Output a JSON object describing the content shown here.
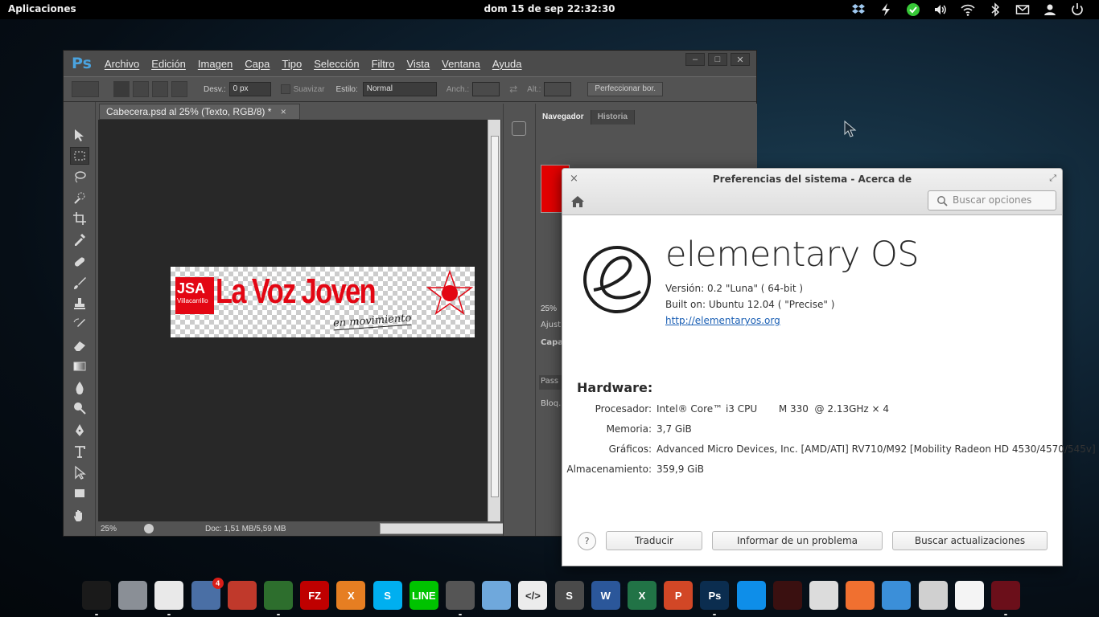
{
  "top_panel": {
    "apps_label": "Aplicaciones",
    "clock": "dom 15 de sep 22:32:30",
    "indicators": [
      "dropbox-icon",
      "power-icon",
      "update-check-icon",
      "volume-icon",
      "wifi-icon",
      "bluetooth-icon",
      "mail-icon",
      "user-icon",
      "shutdown-icon"
    ]
  },
  "photoshop": {
    "logo": "Ps",
    "menu": [
      "Archivo",
      "Edición",
      "Imagen",
      "Capa",
      "Tipo",
      "Selección",
      "Filtro",
      "Vista",
      "Ventana",
      "Ayuda"
    ],
    "window_controls": [
      "–",
      "□",
      "✕"
    ],
    "options": {
      "feather_label": "Desv.:",
      "feather_value": "0 px",
      "antialias_label": "Suavizar",
      "style_label": "Estilo:",
      "style_value": "Normal",
      "width_label": "Anch.:",
      "height_label": "Alt.:",
      "refine_button": "Perfeccionar bor."
    },
    "document_tab": "Cabecera.psd al 25% (Texto, RGB/8) *",
    "document_tab_close": "×",
    "status": {
      "zoom": "25%",
      "doc_size": "Doc: 1,51 MB/5,59 MB"
    },
    "panel_tabs": [
      "Navegador",
      "Historia"
    ],
    "nav_zoom": "25%",
    "panel_labels": [
      "Ajust",
      "Capa",
      "Pass",
      "Bloq.:"
    ],
    "artwork": {
      "badge": "JSA",
      "badge_sub": "Villacarrillo",
      "headline": "La Voz Joven",
      "tagline": "en movimiento"
    }
  },
  "prefs": {
    "title": "Preferencias del sistema - Acerca de",
    "close_icon": "×",
    "search_placeholder": "Buscar opciones",
    "os_name": "elementary OS",
    "version": "Versión: 0.2 \"Luna\" ( 64-bit )",
    "built_on": "Built on: Ubuntu 12.04 ( \"Precise\" )",
    "link": "http://elementaryos.org",
    "hardware_title": "Hardware:",
    "hardware": [
      {
        "label": "Procesador:",
        "value": "Intel® Core™ i3 CPU       M 330  @ 2.13GHz × 4"
      },
      {
        "label": "Memoria:",
        "value": "3,7 GiB"
      },
      {
        "label": "Gráficos:",
        "value": "Advanced Micro Devices, Inc. [AMD/ATI] RV710/M92 [Mobility Radeon HD 4530/4570/545v]"
      },
      {
        "label": "Almacenamiento:",
        "value": "359,9 GiB"
      }
    ],
    "help_label": "?",
    "buttons": {
      "translate": "Traducir",
      "report": "Informar de un problema",
      "updates": "Buscar actualizaciones"
    }
  },
  "dock": {
    "items": [
      {
        "name": "terminal-icon",
        "label": "",
        "color": "#1a1a1a"
      },
      {
        "name": "files-icon",
        "label": "",
        "color": "#8a8f96"
      },
      {
        "name": "chrome-icon",
        "label": "",
        "color": "#e9e9e9"
      },
      {
        "name": "mail-icon",
        "label": "",
        "color": "#4a6fa5",
        "badge": "4"
      },
      {
        "name": "installer-icon",
        "label": "",
        "color": "#c0392b"
      },
      {
        "name": "bitcoin-icon",
        "label": "",
        "color": "#2d6e2d"
      },
      {
        "name": "filezilla-icon",
        "label": "FZ",
        "color": "#bf0000"
      },
      {
        "name": "xchat-icon",
        "label": "X",
        "color": "#e67e22"
      },
      {
        "name": "skype-icon",
        "label": "S",
        "color": "#00aff0"
      },
      {
        "name": "line-icon",
        "label": "LINE",
        "color": "#00c300"
      },
      {
        "name": "calculator-icon",
        "label": "",
        "color": "#555"
      },
      {
        "name": "virtualbox-icon",
        "label": "",
        "color": "#6fa8dc"
      },
      {
        "name": "code-editor-icon",
        "label": "</>",
        "color": "#ececec"
      },
      {
        "name": "sublime-icon",
        "label": "S",
        "color": "#4a4a4a"
      },
      {
        "name": "word-icon",
        "label": "W",
        "color": "#2b579a"
      },
      {
        "name": "excel-icon",
        "label": "X",
        "color": "#217346"
      },
      {
        "name": "powerpoint-icon",
        "label": "P",
        "color": "#d24726"
      },
      {
        "name": "photoshop-icon",
        "label": "Ps",
        "color": "#0b2d4f"
      },
      {
        "name": "teamviewer-icon",
        "label": "",
        "color": "#0e8ee9"
      },
      {
        "name": "game-icon",
        "label": "",
        "color": "#3a1010"
      },
      {
        "name": "system-monitor-icon",
        "label": "",
        "color": "#dcdcdc"
      },
      {
        "name": "sync-icon",
        "label": "",
        "color": "#f07030"
      },
      {
        "name": "download-icon",
        "label": "",
        "color": "#3b8fd9"
      },
      {
        "name": "pdf-icon",
        "label": "",
        "color": "#d0d0d0"
      },
      {
        "name": "text-editor-icon",
        "label": "",
        "color": "#f4f4f4"
      },
      {
        "name": "wine-icon",
        "label": "",
        "color": "#6b0f1a"
      }
    ]
  }
}
